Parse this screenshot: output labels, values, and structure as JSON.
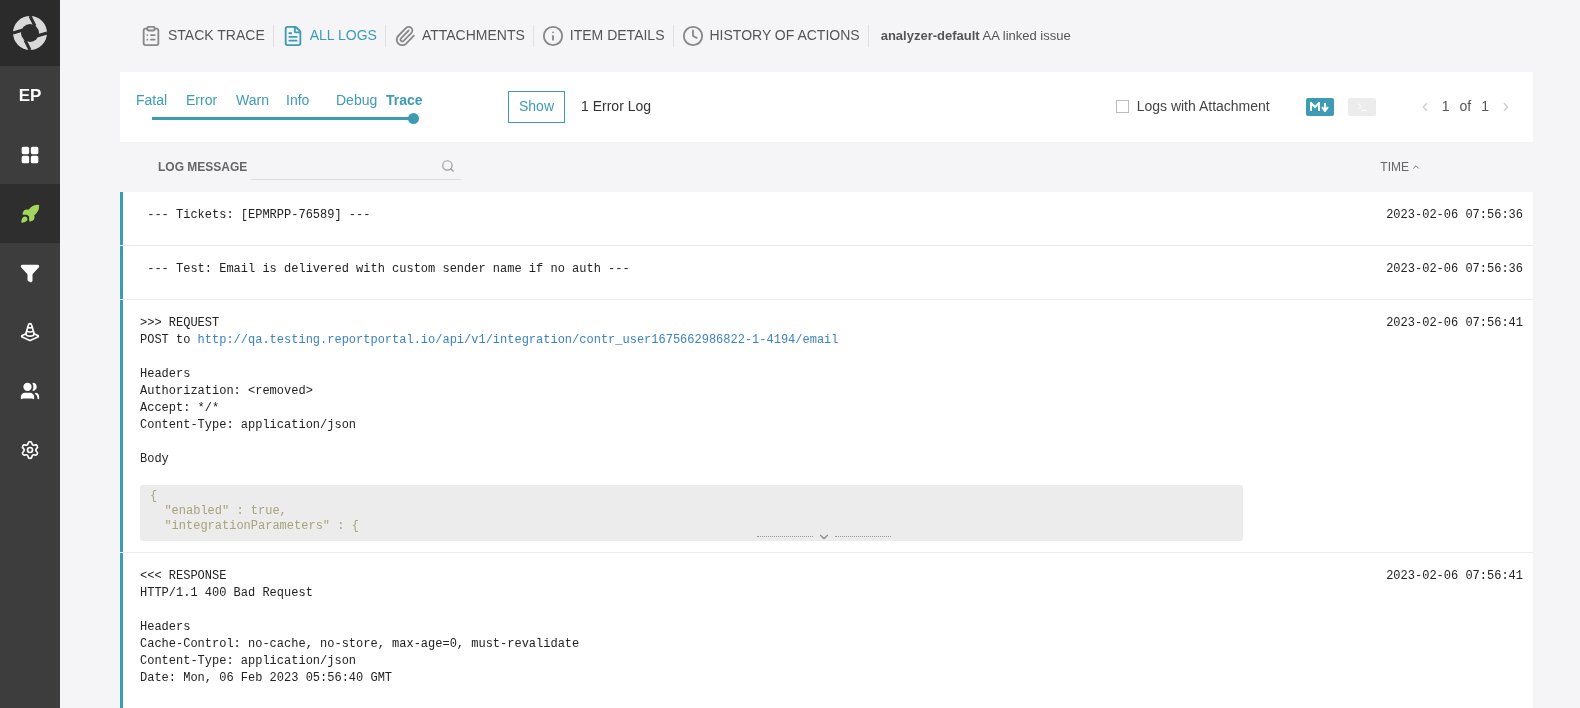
{
  "sidebar": {
    "items": [
      {
        "kind": "logo"
      },
      {
        "kind": "project",
        "label": "EP",
        "selected": false
      },
      {
        "kind": "grid",
        "selected": false
      },
      {
        "kind": "rocket",
        "selected": true
      },
      {
        "kind": "filter",
        "selected": false
      },
      {
        "kind": "cone",
        "selected": false
      },
      {
        "kind": "people",
        "selected": false
      },
      {
        "kind": "gear",
        "selected": false
      }
    ]
  },
  "tabs": [
    {
      "kind": "stack",
      "label": "STACK TRACE",
      "selected": false
    },
    {
      "kind": "logs",
      "label": "ALL LOGS",
      "selected": true
    },
    {
      "kind": "attach",
      "label": "ATTACHMENTS",
      "selected": false
    },
    {
      "kind": "info",
      "label": "ITEM DETAILS",
      "selected": false
    },
    {
      "kind": "history",
      "label": "HISTORY OF ACTIONS",
      "selected": false
    }
  ],
  "analyzer_note": "**analyzer-default** AA linked issue",
  "filter": {
    "levels": [
      {
        "label": "Fatal",
        "selected": false
      },
      {
        "label": "Error",
        "selected": false
      },
      {
        "label": "Warn",
        "selected": false
      },
      {
        "label": "Info",
        "selected": false
      },
      {
        "label": "Debug",
        "selected": false
      },
      {
        "label": "Trace",
        "selected": true
      }
    ],
    "level": 1,
    "show_button": "Show",
    "error_count": "1 Error Log",
    "attachment_checkbox": {
      "label": "Logs with Attachment",
      "checked": false
    },
    "modes": [
      {
        "kind": "markdown",
        "selected": true
      },
      {
        "kind": "console",
        "selected": false
      }
    ],
    "pagination": {
      "current": "1",
      "of": "of",
      "total": "1"
    }
  },
  "columns": {
    "message": "LOG MESSAGE",
    "time": "TIME"
  },
  "logs": [
    {
      "time": "2023-02-06 07:56:36",
      "paragraphs": [
        [
          {
            "kind": "text",
            "text": " --- Tickets: [EPMRPP-76589] ---"
          }
        ]
      ]
    },
    {
      "time": "2023-02-06 07:56:36",
      "paragraphs": [
        [
          {
            "kind": "text",
            "text": " --- Test: Email is delivered with custom sender name if no auth ---"
          }
        ]
      ]
    },
    {
      "time": "2023-02-06 07:56:41",
      "paragraphs": [
        [
          {
            "kind": "text",
            "text": ">>> REQUEST"
          },
          {
            "kind": "link",
            "text": "POST to ",
            "link": "http://qa.testing.reportportal.io/api/v1/integration/contr_user1675662986822-1-4194/email"
          }
        ],
        [
          {
            "kind": "text",
            "text": "Headers"
          },
          {
            "kind": "text",
            "text": "Authorization: <removed>"
          },
          {
            "kind": "text",
            "text": "Accept: */*"
          },
          {
            "kind": "text",
            "text": "Content-Type: application/json"
          }
        ],
        [
          {
            "kind": "text",
            "text": "Body"
          }
        ]
      ],
      "code": [
        "{",
        "  \"enabled\" : true,",
        "  \"integrationParameters\" : {"
      ],
      "collapsed": true
    },
    {
      "time": "2023-02-06 07:56:41",
      "paragraphs": [
        [
          {
            "kind": "text",
            "text": "<<< RESPONSE"
          },
          {
            "kind": "text",
            "text": "HTTP/1.1 400 Bad Request"
          }
        ],
        [
          {
            "kind": "text",
            "text": "Headers"
          },
          {
            "kind": "text",
            "text": "Cache-Control: no-cache, no-store, max-age=0, must-revalidate"
          },
          {
            "kind": "text",
            "text": "Content-Type: application/json"
          },
          {
            "kind": "text",
            "text": "Date: Mon, 06 Feb 2023 05:56:40 GMT"
          }
        ]
      ]
    }
  ]
}
